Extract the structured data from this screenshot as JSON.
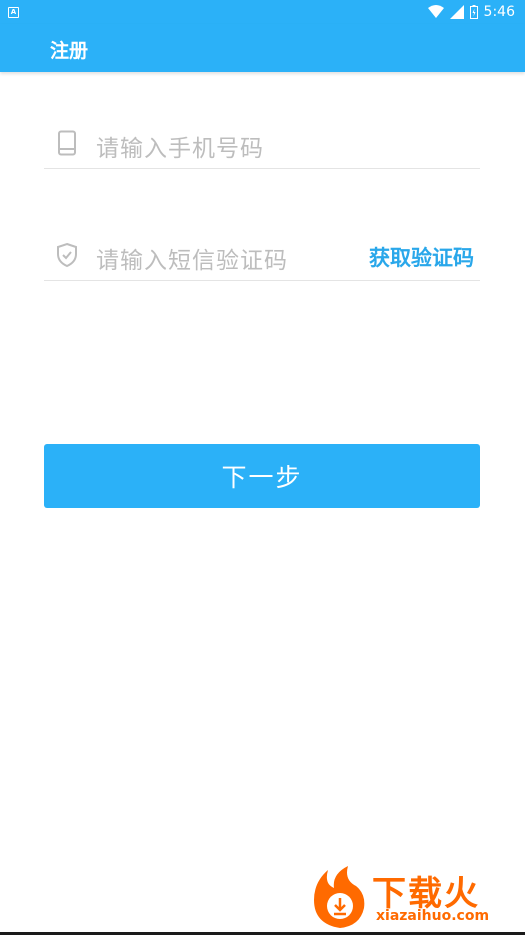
{
  "status_bar": {
    "time": "5:46",
    "app_badge": "A"
  },
  "app_bar": {
    "title": "注册"
  },
  "form": {
    "phone_placeholder": "请输入手机号码",
    "code_placeholder": "请输入短信验证码",
    "get_code_label": "获取验证码",
    "next_label": "下一步"
  },
  "watermark": {
    "title": "下载火",
    "subtitle": "xiazaihuo.com"
  },
  "colors": {
    "primary": "#2bb1f8",
    "link": "#29a7ea",
    "watermark": "#ff6a00"
  }
}
